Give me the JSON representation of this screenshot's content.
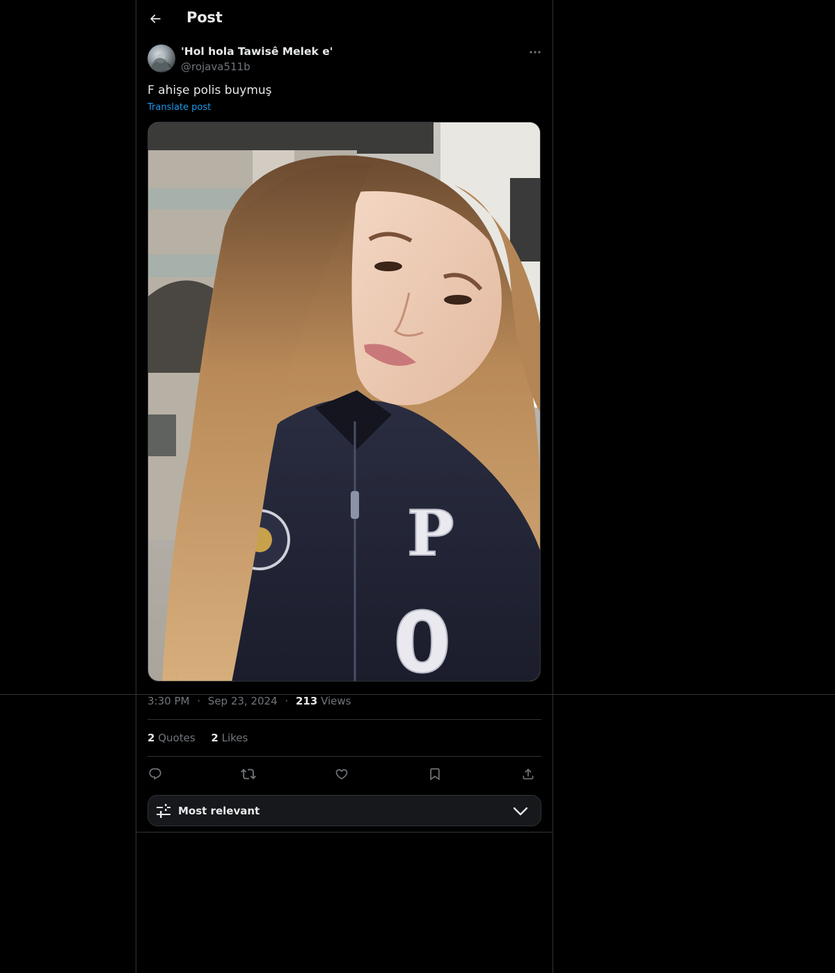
{
  "header": {
    "title": "Post",
    "back_icon": "arrow-left-icon"
  },
  "post": {
    "author_name": "'Hol hola Tawisê Melek e'",
    "author_handle": "@rojava511b",
    "text": "F ahişe polis buymuş",
    "translate_label": "Translate post",
    "time": "3:30 PM",
    "date": "Sep 23, 2024",
    "views_count": "213",
    "views_label": "Views",
    "quotes_count": "2",
    "quotes_label": "Quotes",
    "likes_count": "2",
    "likes_label": "Likes",
    "separator": "·"
  },
  "actions": {
    "reply_icon": "reply-icon",
    "repost_icon": "repost-icon",
    "like_icon": "heart-icon",
    "bookmark_icon": "bookmark-icon",
    "share_icon": "share-icon"
  },
  "replies_sort": {
    "label": "Most relevant"
  },
  "colors": {
    "background": "#000000",
    "text_primary": "#e7e9ea",
    "text_secondary": "#71767b",
    "accent": "#1d9bf0",
    "border": "#2f3336"
  }
}
